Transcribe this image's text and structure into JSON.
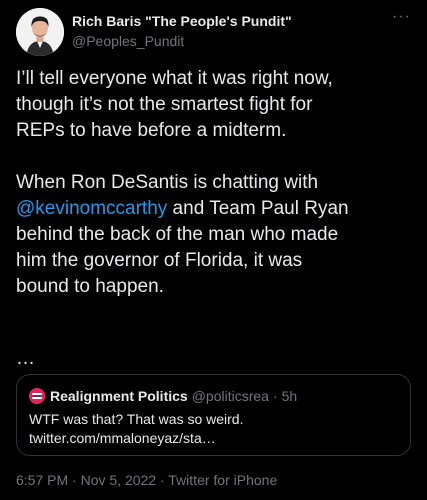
{
  "author": {
    "display_name": "Rich Baris \"The People's Pundit\"",
    "handle": "@Peoples_Pundit",
    "more_label": "···"
  },
  "tweet": {
    "line1": "I’ll tell everyone what it was right now,",
    "line2": "though it’s not the smartest fight for",
    "line3": "REPs to have before a midterm.",
    "line4": "When Ron DeSantis is chatting with",
    "mention": "@kevinomccarthy",
    "line5_rest": " and Team Paul Ryan",
    "line6": "behind the back of the man who made",
    "line7": "him the governor of Florida, it was",
    "line8": "bound to happen.",
    "ellipsis": "…"
  },
  "quoted": {
    "name": "Realignment Politics",
    "handle": "@politicsrea",
    "separator": "·",
    "time": "5h",
    "text_line1": "WTF was that? That was so weird.",
    "text_line2": "twitter.com/mmaloneyaz/sta…"
  },
  "footer": {
    "time": "6:57 PM",
    "sep1": "·",
    "date": "Nov 5, 2022",
    "sep2": "·",
    "source": "Twitter for iPhone"
  },
  "colors": {
    "accent": "#1d9bf0",
    "text": "#e7e9ea",
    "muted": "#71767b",
    "background": "#000000"
  }
}
